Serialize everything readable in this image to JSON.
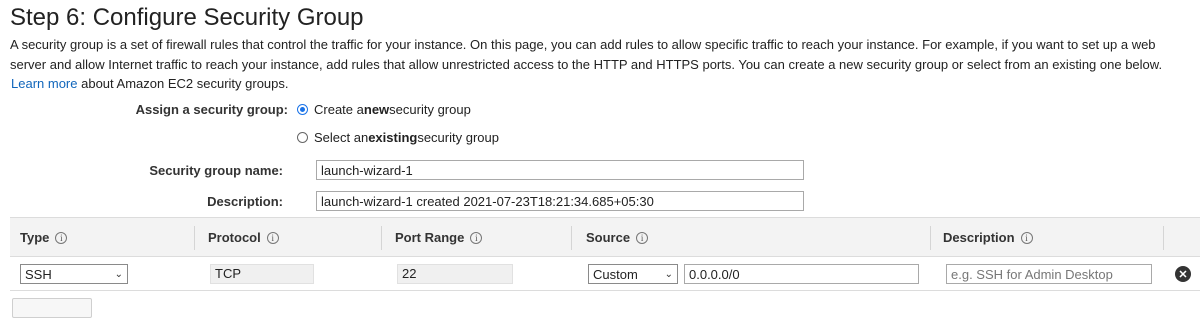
{
  "header": {
    "title": "Step 6: Configure Security Group"
  },
  "intro": {
    "line1": "A security group is a set of firewall rules that control the traffic for your instance. On this page, you can add rules to allow specific traffic to reach your instance. For example, if you want to set up a web",
    "line2": "server and allow Internet traffic to reach your instance, add rules that allow unrestricted access to the HTTP and HTTPS ports. You can create a new security group or select from an existing one below.",
    "learn_more": "Learn more",
    "line3_rest": "about Amazon EC2 security groups."
  },
  "assign": {
    "label": "Assign a security group:",
    "options": [
      {
        "pre": "Create a ",
        "bold": "new",
        "post": " security group",
        "selected": true
      },
      {
        "pre": "Select an ",
        "bold": "existing",
        "post": " security group",
        "selected": false
      }
    ]
  },
  "form": {
    "name_label": "Security group name:",
    "name_value": "launch-wizard-1",
    "desc_label": "Description:",
    "desc_value": "launch-wizard-1 created 2021-07-23T18:21:34.685+05:30"
  },
  "table": {
    "headers": [
      "Type",
      "Protocol",
      "Port Range",
      "Source",
      "Description"
    ],
    "rows": [
      {
        "type": "SSH",
        "protocol": "TCP",
        "port_range": "22",
        "source_mode": "Custom",
        "source_cidr": "0.0.0.0/0",
        "description_placeholder": "e.g. SSH for Admin Desktop"
      }
    ]
  },
  "icons": {
    "info": "info-icon",
    "remove": "remove-rule-icon",
    "dropdown": "chevron-down-icon"
  },
  "colors": {
    "link": "#1166bb",
    "radio_selected": "#1a73e8",
    "header_bg": "#f3f3f3"
  }
}
